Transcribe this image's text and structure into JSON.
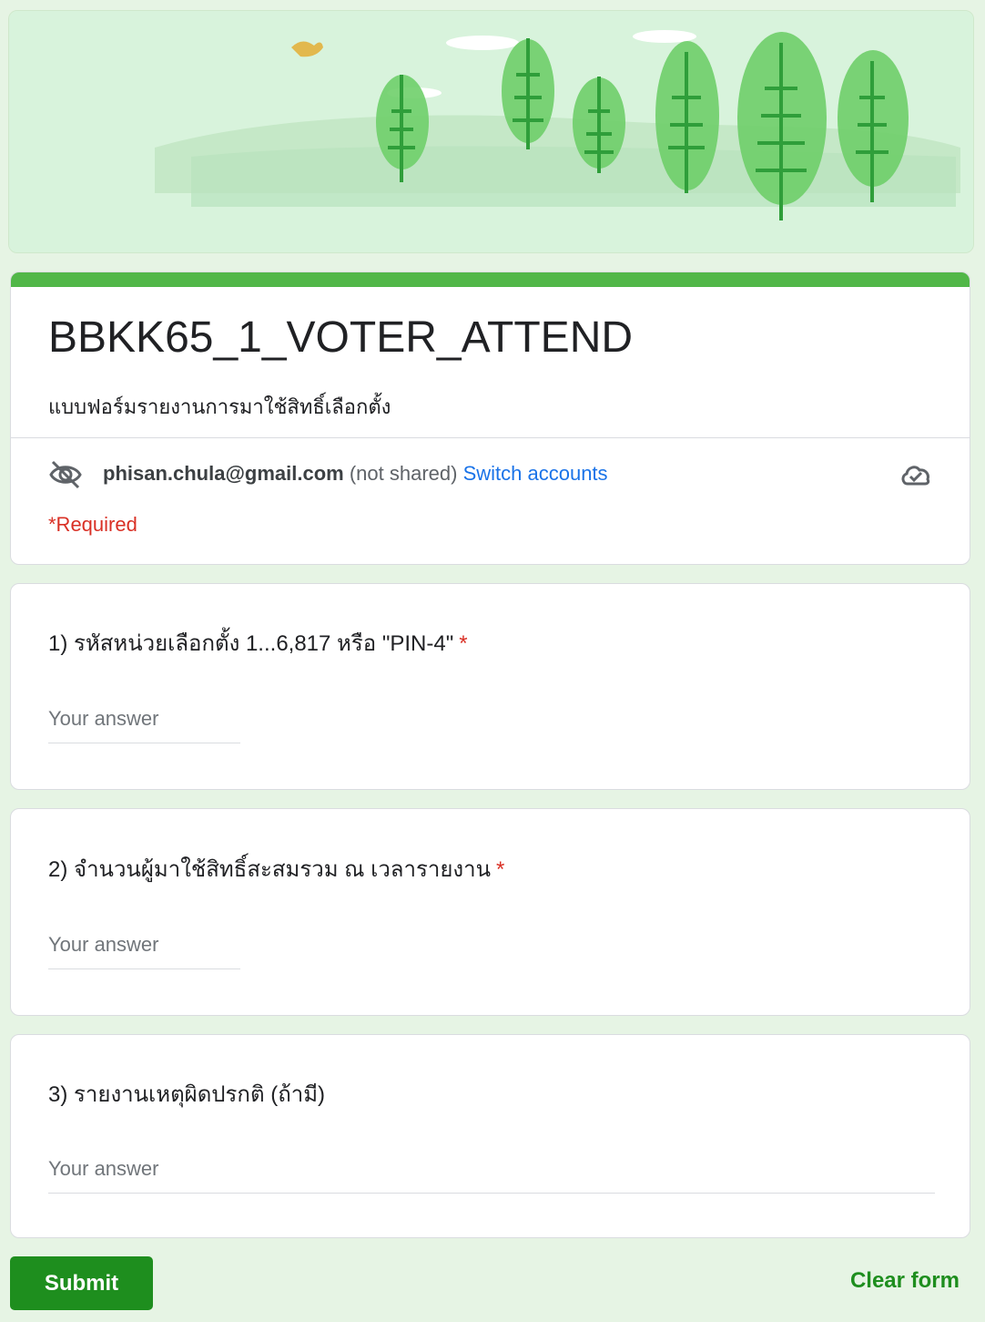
{
  "form": {
    "title": "BBKK65_1_VOTER_ATTEND",
    "description": "แบบฟอร์มรายงานการมาใช้สิทธิ์เลือกตั้ง",
    "account_email": "phisan.chula@gmail.com",
    "account_note": " (not shared) ",
    "switch_accounts": "Switch accounts",
    "required_note": "*Required"
  },
  "questions": [
    {
      "title": "1) รหัสหน่วยเลือกตั้ง 1...6,817 หรือ \"PIN-4\"",
      "required_mark": "*",
      "placeholder": "Your answer"
    },
    {
      "title": "2) จำนวนผู้มาใช้สิทธิ์สะสมรวม ณ เวลารายงาน",
      "required_mark": "*",
      "placeholder": "Your answer"
    },
    {
      "title": "3) รายงานเหตุผิดปรกติ (ถ้ามี)",
      "placeholder": "Your answer"
    }
  ],
  "actions": {
    "submit": "Submit",
    "clear": "Clear form"
  },
  "icons": {
    "visibility": "eye-off-icon",
    "cloud": "cloud-check-icon"
  },
  "colors": {
    "background": "#e6f4e4",
    "accent": "#51b748",
    "submit": "#1e8e1e",
    "link": "#1a73e8",
    "required": "#d93025"
  }
}
